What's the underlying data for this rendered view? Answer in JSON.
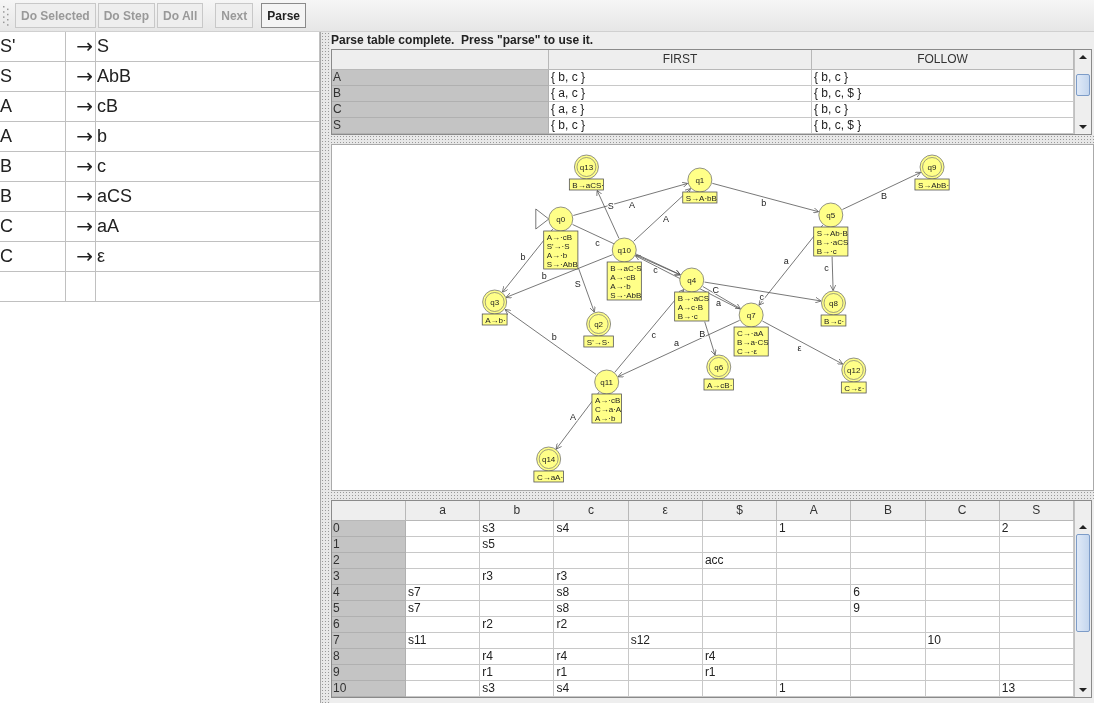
{
  "toolbar": {
    "buttons": [
      {
        "label": "Do Selected",
        "disabled": true
      },
      {
        "label": "Do Step",
        "disabled": true
      },
      {
        "label": "Do All",
        "disabled": true
      },
      {
        "label": "Next",
        "disabled": true
      },
      {
        "label": "Parse",
        "disabled": false
      }
    ]
  },
  "grammar": {
    "rows": [
      {
        "lhs": "S'",
        "arrow": "→",
        "rhs": "S"
      },
      {
        "lhs": "S",
        "arrow": "→",
        "rhs": "AbB"
      },
      {
        "lhs": "A",
        "arrow": "→",
        "rhs": "cB"
      },
      {
        "lhs": "A",
        "arrow": "→",
        "rhs": "b"
      },
      {
        "lhs": "B",
        "arrow": "→",
        "rhs": "c"
      },
      {
        "lhs": "B",
        "arrow": "→",
        "rhs": "aCS"
      },
      {
        "lhs": "C",
        "arrow": "→",
        "rhs": "aA"
      },
      {
        "lhs": "C",
        "arrow": "→",
        "rhs": "ε"
      }
    ]
  },
  "message": "Parse table complete.  Press \"parse\" to use it.",
  "first_follow": {
    "columns": [
      "FIRST",
      "FOLLOW"
    ],
    "rows": [
      {
        "symbol": "A",
        "first": "{ b, c }",
        "follow": "{ b, c }"
      },
      {
        "symbol": "B",
        "first": "{ a, c }",
        "follow": "{ b, c, $ }"
      },
      {
        "symbol": "C",
        "first": "{ a, ε }",
        "follow": "{ b, c }"
      },
      {
        "symbol": "S",
        "first": "{ b, c }",
        "follow": "{ b, c, $ }"
      }
    ]
  },
  "diagram": {
    "states": [
      {
        "name": "q0",
        "initial": true,
        "final": false,
        "items": [
          "A→·cB",
          "S'→·S",
          "A→·b",
          "S→·AbB"
        ]
      },
      {
        "name": "q1",
        "initial": false,
        "final": false,
        "items": [
          "S→A·bB"
        ]
      },
      {
        "name": "q2",
        "initial": false,
        "final": true,
        "items": [
          "S'→S·"
        ]
      },
      {
        "name": "q3",
        "initial": false,
        "final": true,
        "items": [
          "A→b·"
        ]
      },
      {
        "name": "q4",
        "initial": false,
        "final": false,
        "items": [
          "B→·aCS",
          "A→c·B",
          "B→·c"
        ]
      },
      {
        "name": "q5",
        "initial": false,
        "final": false,
        "items": [
          "S→Ab·B",
          "B→·aCS",
          "B→·c"
        ]
      },
      {
        "name": "q6",
        "initial": false,
        "final": true,
        "items": [
          "A→cB·"
        ]
      },
      {
        "name": "q7",
        "initial": false,
        "final": false,
        "items": [
          "C→·aA",
          "B→a·CS",
          "C→·ε"
        ]
      },
      {
        "name": "q8",
        "initial": false,
        "final": true,
        "items": [
          "B→c·"
        ]
      },
      {
        "name": "q9",
        "initial": false,
        "final": true,
        "items": [
          "S→AbB·"
        ]
      },
      {
        "name": "q10",
        "initial": false,
        "final": false,
        "items": [
          "B→aC·S",
          "A→·cB",
          "A→·b",
          "S→·AbB"
        ]
      },
      {
        "name": "q11",
        "initial": false,
        "final": false,
        "items": [
          "A→·cB",
          "C→a·A",
          "A→·b"
        ]
      },
      {
        "name": "q12",
        "initial": false,
        "final": true,
        "items": [
          "C→ε·"
        ]
      },
      {
        "name": "q13",
        "initial": false,
        "final": true,
        "items": [
          "B→aCS·"
        ]
      },
      {
        "name": "q14",
        "initial": false,
        "final": true,
        "items": [
          "C→aA·"
        ]
      }
    ],
    "transitions": [
      {
        "label": "b"
      },
      {
        "label": "c"
      },
      {
        "label": "A"
      },
      {
        "label": "S"
      },
      {
        "label": "b"
      },
      {
        "label": "a"
      },
      {
        "label": "c"
      },
      {
        "label": "B"
      },
      {
        "label": "a"
      },
      {
        "label": "c"
      },
      {
        "label": "B"
      },
      {
        "label": "a"
      },
      {
        "label": "ε"
      },
      {
        "label": "C"
      },
      {
        "label": "b"
      },
      {
        "label": "c"
      },
      {
        "label": "A"
      },
      {
        "label": "S"
      },
      {
        "label": "b"
      },
      {
        "label": "c"
      },
      {
        "label": "A"
      }
    ]
  },
  "parse_table": {
    "columns": [
      "a",
      "b",
      "c",
      "ε",
      "$",
      "A",
      "B",
      "C",
      "S"
    ],
    "rows": [
      {
        "state": "0",
        "cells": [
          null,
          "s3",
          "s4",
          null,
          null,
          "1",
          null,
          null,
          "2"
        ]
      },
      {
        "state": "1",
        "cells": [
          null,
          "s5",
          null,
          null,
          null,
          null,
          null,
          null,
          null
        ]
      },
      {
        "state": "2",
        "cells": [
          null,
          null,
          null,
          null,
          "acc",
          null,
          null,
          null,
          null
        ]
      },
      {
        "state": "3",
        "cells": [
          null,
          "r3",
          "r3",
          null,
          null,
          null,
          null,
          null,
          null
        ]
      },
      {
        "state": "4",
        "cells": [
          "s7",
          null,
          "s8",
          null,
          null,
          null,
          "6",
          null,
          null
        ]
      },
      {
        "state": "5",
        "cells": [
          "s7",
          null,
          "s8",
          null,
          null,
          null,
          "9",
          null,
          null
        ]
      },
      {
        "state": "6",
        "cells": [
          null,
          "r2",
          "r2",
          null,
          null,
          null,
          null,
          null,
          null
        ]
      },
      {
        "state": "7",
        "cells": [
          "s11",
          null,
          null,
          "s12",
          null,
          null,
          null,
          "10",
          null
        ]
      },
      {
        "state": "8",
        "cells": [
          null,
          "r4",
          "r4",
          null,
          "r4",
          null,
          null,
          null,
          null
        ]
      },
      {
        "state": "9",
        "cells": [
          null,
          "r1",
          "r1",
          null,
          "r1",
          null,
          null,
          null,
          null
        ]
      },
      {
        "state": "10",
        "cells": [
          null,
          "s3",
          "s4",
          null,
          null,
          "1",
          null,
          null,
          "13"
        ]
      }
    ]
  }
}
